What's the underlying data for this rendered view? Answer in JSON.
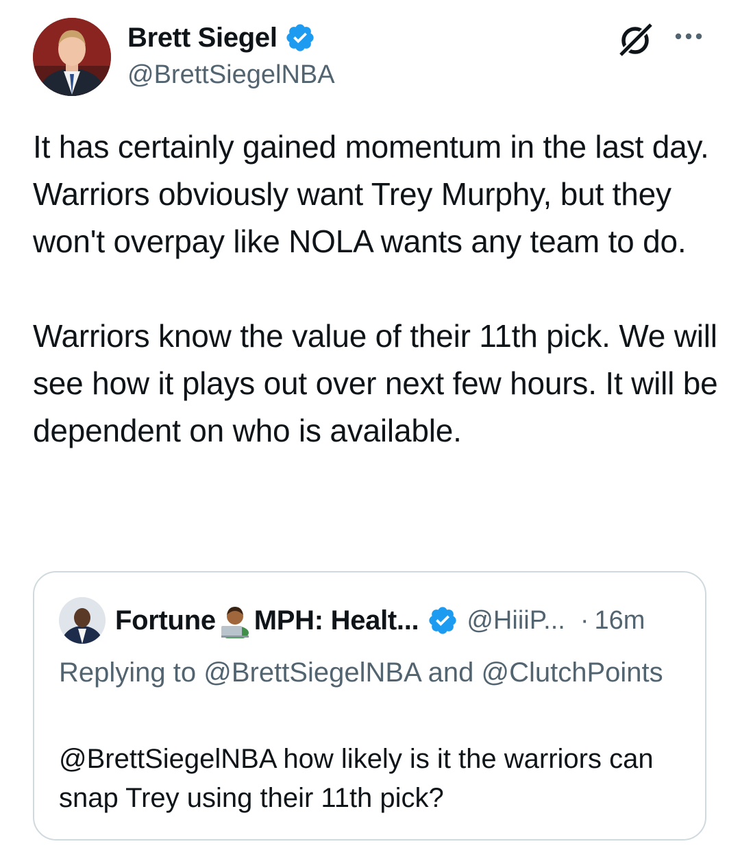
{
  "author": {
    "display_name": "Brett Siegel",
    "handle": "@BrettSiegelNBA",
    "verified": true,
    "avatar": "profile-photo"
  },
  "tweet": {
    "paragraph_1": "It has certainly gained momentum in the last day. Warriors obviously want Trey Murphy, but they won't overpay like NOLA wants any team to do.",
    "paragraph_2": "Warriors know the value of their 11th pick. We will see how it plays out over next few hours. It will be dependent on who is available."
  },
  "actions": {
    "grok_icon": "grok-icon",
    "more_icon": "more-options-icon"
  },
  "quoted": {
    "name_part1": "Fortune",
    "name_part2": "MPH: Healt...",
    "emoji": "technologist-emoji",
    "verified": true,
    "handle": "@HiiiP...",
    "dot": "·",
    "time": "16m",
    "replying_to": "Replying to @BrettSiegelNBA and @ClutchPoints",
    "text": "@BrettSiegelNBA how likely is it the warriors can snap Trey using their 11th pick?"
  },
  "colors": {
    "text_primary": "#0f1419",
    "text_secondary": "#536471",
    "verified_blue": "#1d9bf0",
    "border": "#cfd9de"
  }
}
